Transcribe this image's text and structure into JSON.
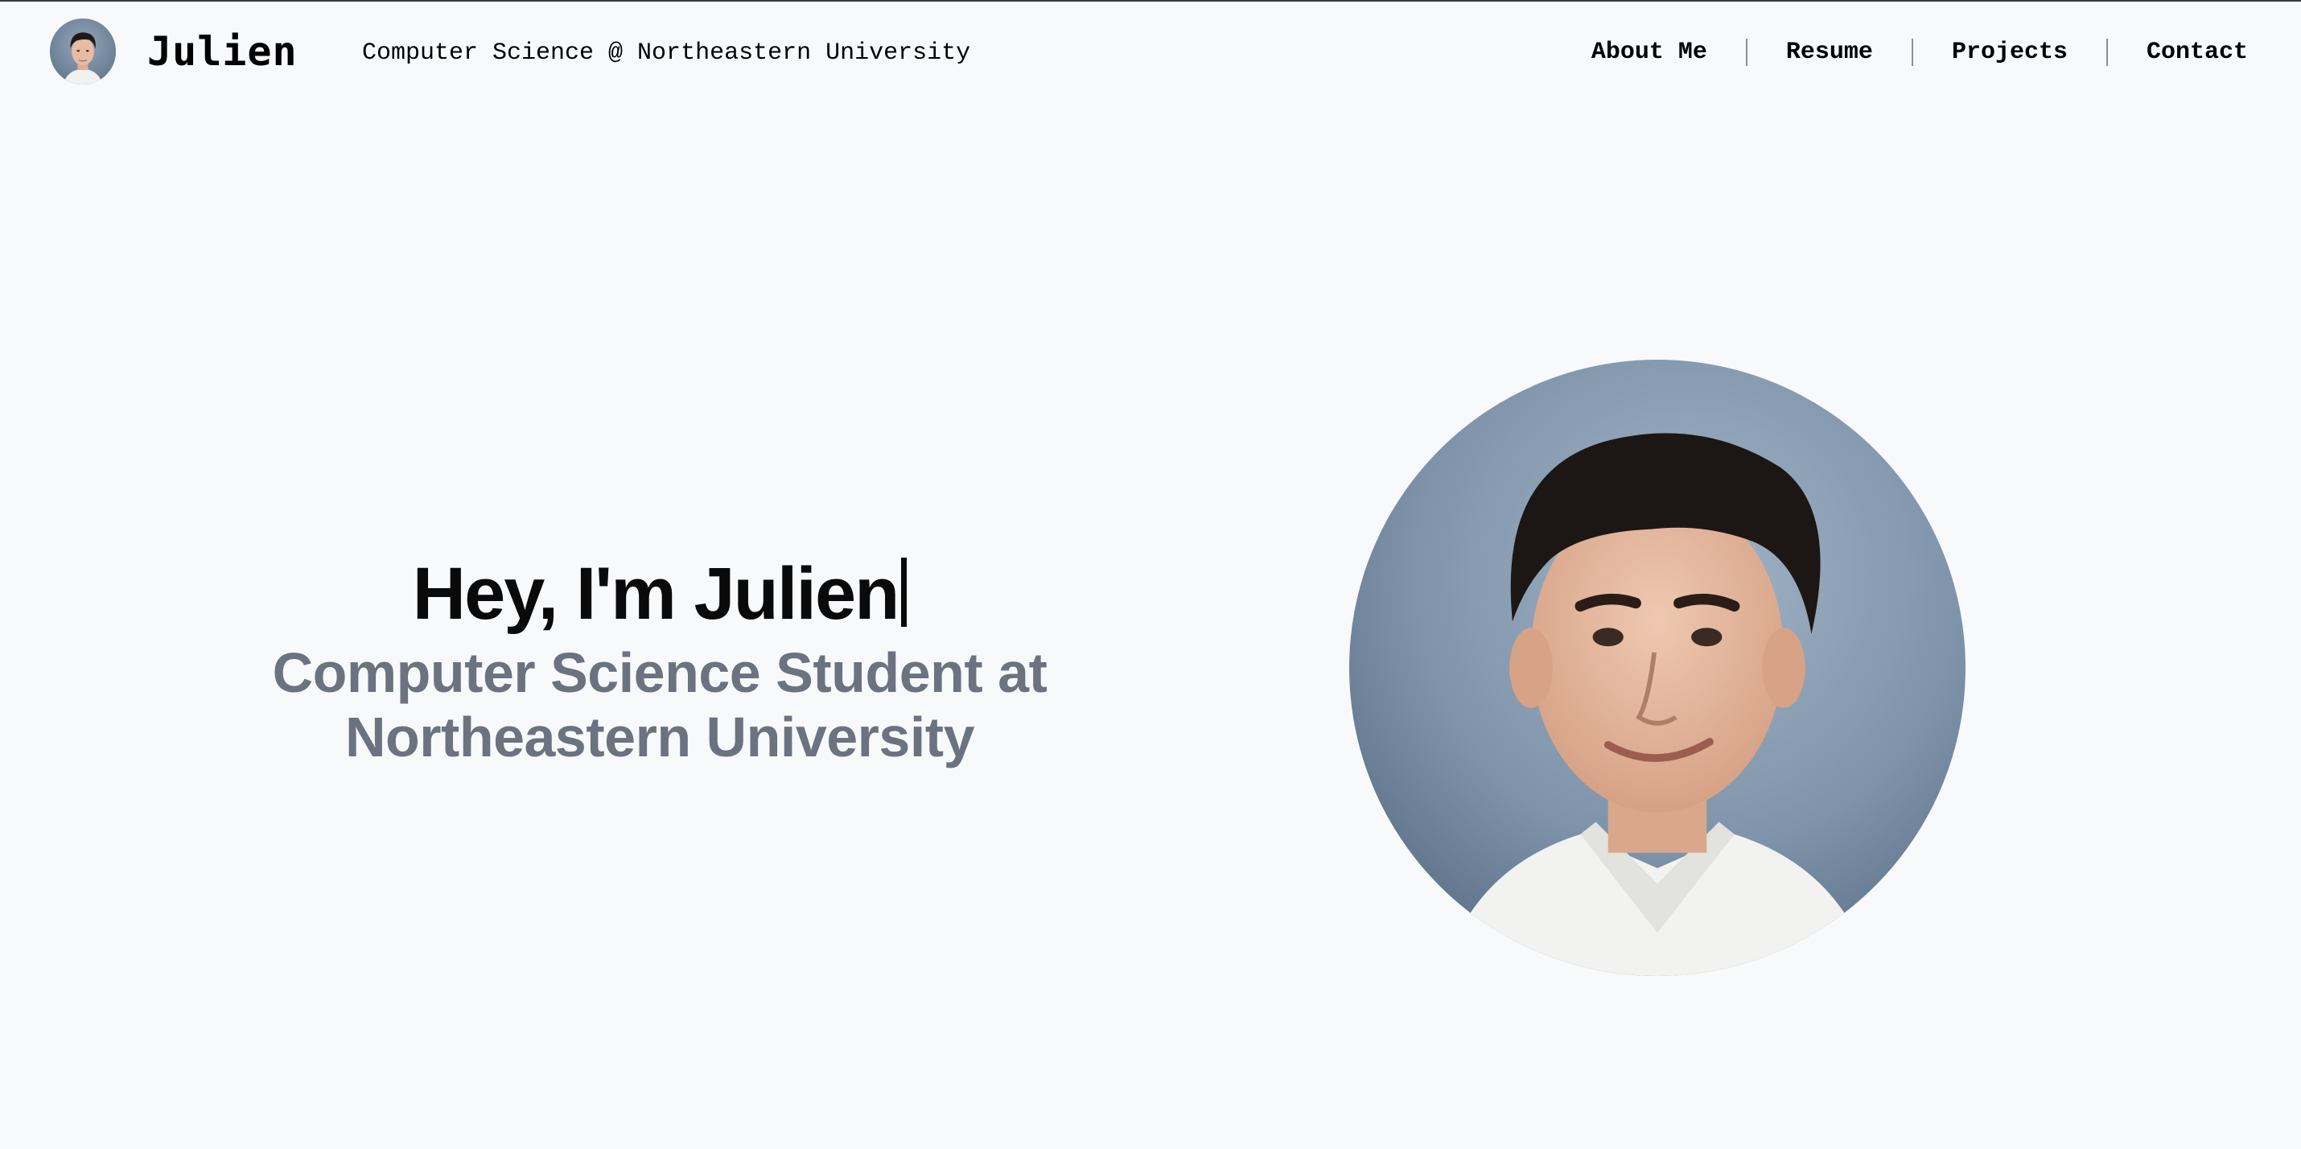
{
  "header": {
    "brand_name": "Julien",
    "tagline": "Computer Science @ Northeastern University",
    "avatar_icon": "profile-avatar"
  },
  "nav": {
    "items": [
      {
        "label": "About Me"
      },
      {
        "label": "Resume"
      },
      {
        "label": "Projects"
      },
      {
        "label": "Contact"
      }
    ]
  },
  "hero": {
    "heading": "Hey, I'm Julien",
    "subtitle": "Computer Science Student at Northeastern University",
    "photo_icon": "profile-photo"
  },
  "colors": {
    "background": "#f8f9fb",
    "heading": "#0a0a0a",
    "subtitle": "#6b7280",
    "nav_separator": "#8e8e8e"
  }
}
